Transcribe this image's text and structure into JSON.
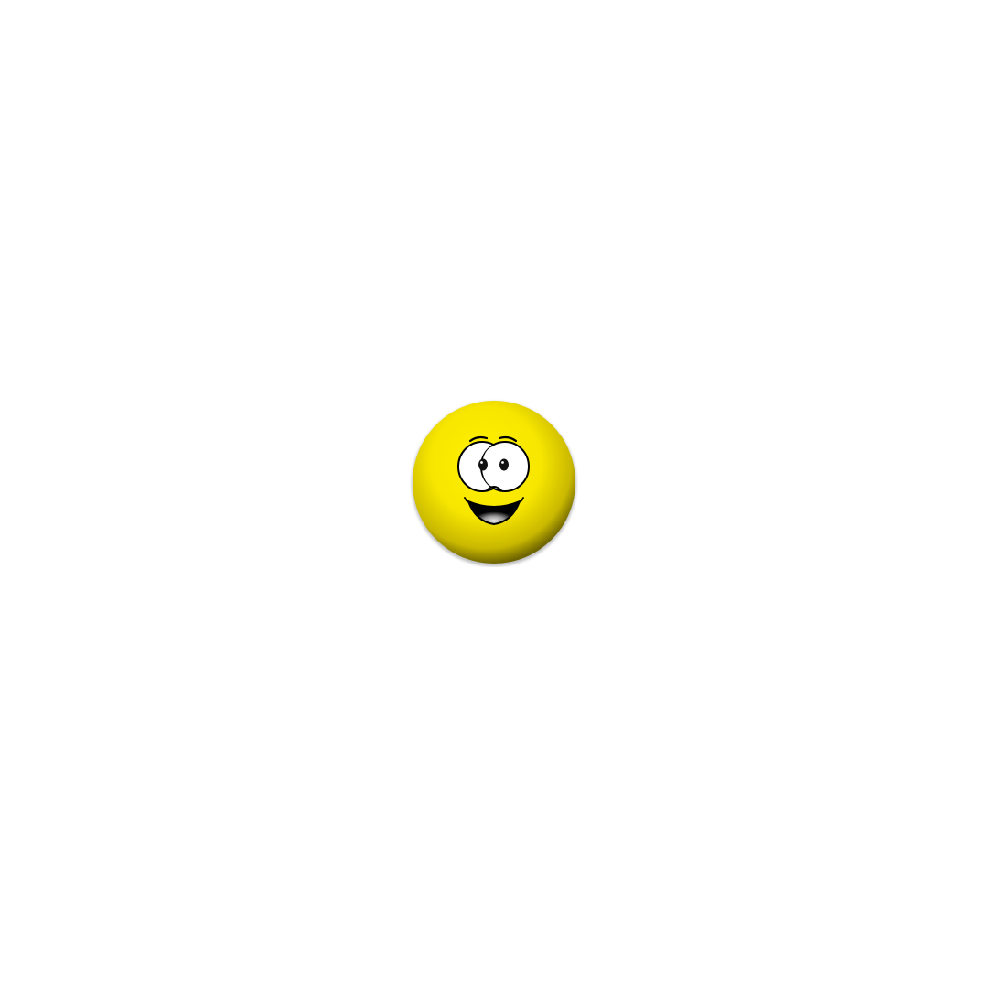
{
  "scene": {
    "background_color": "#ffffff",
    "subject": {
      "icon": "smiley-face-icon",
      "colors": {
        "face_highlight": "#fff200",
        "face_main": "#f7e600",
        "face_shade": "#c9b800",
        "face_edge": "#6e6400",
        "eye_white": "#ffffff",
        "outline": "#000000",
        "tongue": "#9a9a9a"
      }
    }
  }
}
